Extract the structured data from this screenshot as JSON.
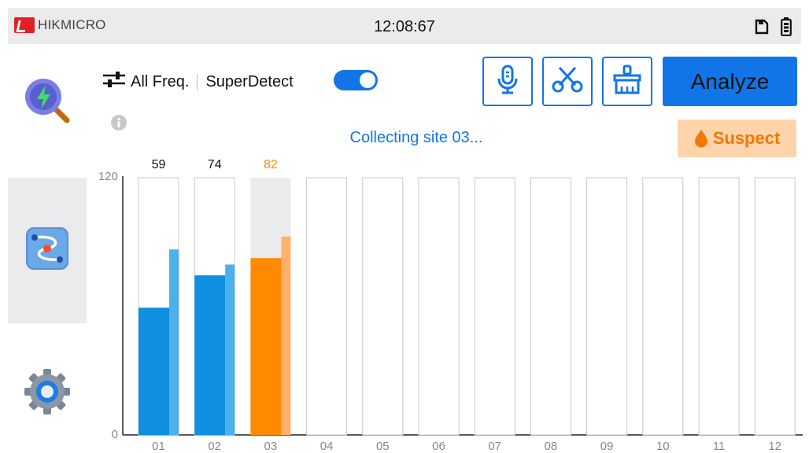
{
  "status_bar": {
    "brand": "HIKMICRO",
    "time": "12:08:67",
    "icons": [
      "sd-card-icon",
      "battery-icon"
    ]
  },
  "sidebar": {
    "items": [
      {
        "name": "analyze",
        "icon": "magnifier-bolt-icon",
        "active": false
      },
      {
        "name": "route",
        "icon": "route-icon",
        "active": true
      },
      {
        "name": "settings",
        "icon": "gear-icon",
        "active": false
      }
    ]
  },
  "toolbar": {
    "freq_label": "All Freq.",
    "superdetect_label": "SuperDetect",
    "superdetect_on": true,
    "tools": [
      "microphone-icon",
      "scissors-icon",
      "broom-icon"
    ],
    "analyze_label": "Analyze"
  },
  "status": {
    "collecting": "Collecting site 03...",
    "suspect": "Suspect"
  },
  "colors": {
    "accent": "#1175e8",
    "bar_normal": "#0f8fe0",
    "bar_normal_light": "#4cb1ea",
    "bar_suspect": "#ff8a00",
    "bar_suspect_light": "#ffb06a",
    "suspect_bg": "#ffd4ab"
  },
  "chart_data": {
    "type": "bar",
    "ylim": [
      0,
      120
    ],
    "yticks": [
      "0",
      "120"
    ],
    "categories": [
      "01",
      "02",
      "03",
      "04",
      "05",
      "06",
      "07",
      "08",
      "09",
      "10",
      "11",
      "12"
    ],
    "value_labels": [
      "59",
      "74",
      "82",
      "",
      "",
      "",
      "",
      "",
      "",
      "",
      "",
      ""
    ],
    "series": [
      {
        "values": [
          59,
          74,
          82,
          null,
          null,
          null,
          null,
          null,
          null,
          null,
          null,
          null
        ]
      },
      {
        "values": [
          86,
          79,
          92,
          null,
          null,
          null,
          null,
          null,
          null,
          null,
          null,
          null
        ]
      }
    ],
    "highlight_index": 2
  }
}
